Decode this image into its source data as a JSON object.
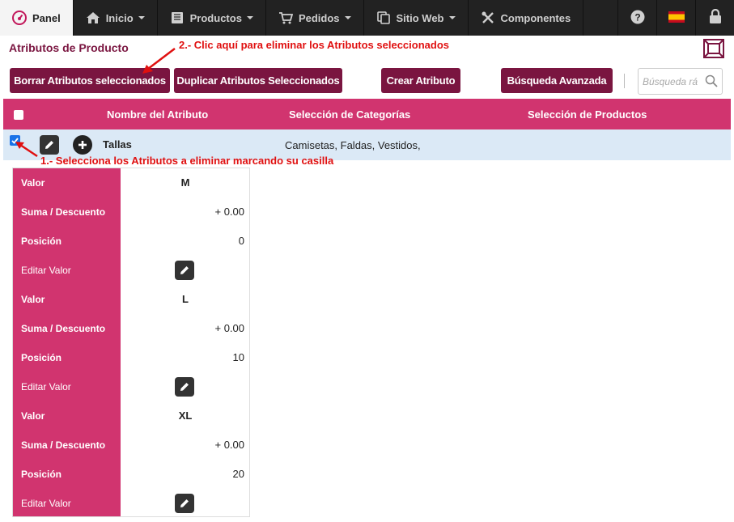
{
  "nav": {
    "panel": "Panel",
    "inicio": "Inicio",
    "productos": "Productos",
    "pedidos": "Pedidos",
    "sitio_web": "Sitio Web",
    "componentes": "Componentes"
  },
  "page": {
    "title": "Atributos de Producto",
    "annotation_delete": "2.- Clic aquí para eliminar los Atributos seleccionados",
    "annotation_select": "1.- Selecciona los Atributos a eliminar marcando su casilla"
  },
  "toolbar": {
    "delete_label": "Borrar Atributos seleccionados",
    "duplicate_label": "Duplicar Atributos Seleccionados",
    "create_label": "Crear Atributo",
    "advanced_search_label": "Búsqueda Avanzada",
    "search_placeholder": "Búsqueda rá"
  },
  "table": {
    "headers": [
      "Nombre del Atributo",
      "Selección de Categorías",
      "Selección de Productos"
    ],
    "rows": [
      {
        "name": "Tallas",
        "categories": "Camisetas, Faldas, Vestidos,",
        "checked": true
      }
    ]
  },
  "values_panel": {
    "labels": {
      "value": "Valor",
      "adjust": "Suma / Descuento",
      "position": "Posición",
      "edit": "Editar Valor"
    },
    "items": [
      {
        "value": "M",
        "adjust": "+ 0.00",
        "position": "0"
      },
      {
        "value": "L",
        "adjust": "+ 0.00",
        "position": "10"
      },
      {
        "value": "XL",
        "adjust": "+ 0.00",
        "position": "20"
      }
    ]
  },
  "colors": {
    "accent": "#d1346f",
    "button": "#7a1540",
    "nav_bg": "#222222",
    "row_bg": "#dbe9f6",
    "annotation": "#e01010"
  }
}
